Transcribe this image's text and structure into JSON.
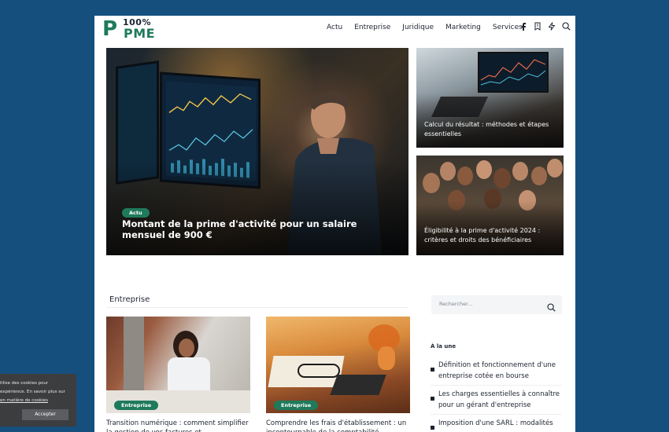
{
  "logo": {
    "mark": "P",
    "percent": "100%",
    "name": "PME"
  },
  "nav": {
    "items": [
      "Actu",
      "Entreprise",
      "Juridique",
      "Marketing",
      "Services"
    ]
  },
  "header_icons": [
    "facebook-icon",
    "bookmark-icon",
    "bolt-icon",
    "search-icon"
  ],
  "hero": {
    "badge": "Actu",
    "title": "Montant de la prime d'activité pour un salaire mensuel de 900 €"
  },
  "side_cards": [
    {
      "title": "Calcul du résultat : méthodes et étapes essentielles"
    },
    {
      "title": "Éligibilité à la prime d'activité 2024 : critères et droits des bénéficiaires"
    }
  ],
  "section": {
    "title": "Entreprise"
  },
  "cards": [
    {
      "badge": "Entreprise",
      "title": "Transition numérique : comment simplifier la gestion de vos factures et"
    },
    {
      "badge": "Entreprise",
      "title": "Comprendre les frais d'établissement : un incontournable de la comptabilité"
    }
  ],
  "search": {
    "placeholder": "Rechercher..."
  },
  "sidebar": {
    "heading": "À la une",
    "items": [
      "Définition et fonctionnement d'une entreprise cotée en bourse",
      "Les charges essentielles à connaître pour un gérant d'entreprise",
      "Imposition d'une SARL : modalités"
    ]
  },
  "cookie": {
    "line1": "tilise des cookies pour",
    "line2": "expérience. En savoir plus sur",
    "link": "en matière de cookies",
    "button": "Accepter"
  },
  "colors": {
    "background": "#154f7e",
    "brand": "#1f7a5c",
    "text": "#1d2430"
  }
}
